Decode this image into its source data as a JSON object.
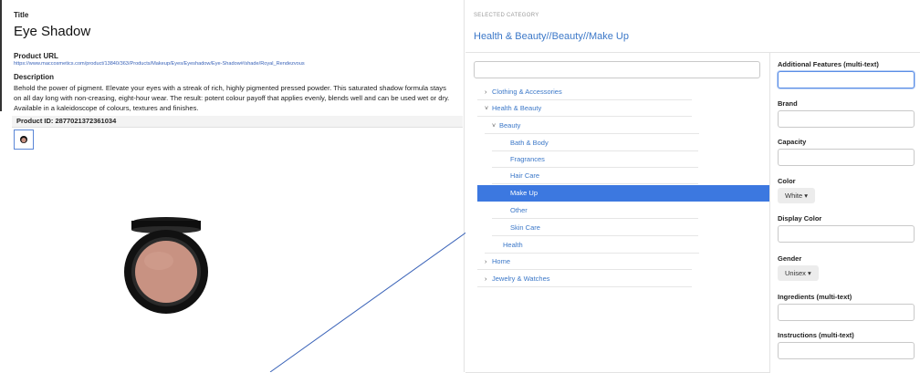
{
  "product": {
    "title_label": "Title",
    "title": "Eye Shadow",
    "url_label": "Product URL",
    "url": "https://www.maccosmetics.com/product/13840/363/Products/Makeup/Eyes/Eyeshadow/Eye-Shadow#/shade/Royal_Rendezvous",
    "description_label": "Description",
    "description": "Behold the power of pigment. Elevate your eyes with a streak of rich, highly pigmented pressed powder. This saturated shadow formula stays on all day long with non-creasing, eight-hour wear. The result: potent colour payoff that applies evenly, blends well and can be used wet or dry. Available in a kaleidoscope of colours, textures and finishes.",
    "product_id": "Product ID: 2877021372361034",
    "image_name": "eyeshadow-compact-image"
  },
  "category": {
    "caption": "SELECTED CATEGORY",
    "path": "Health & Beauty//Beauty//Make Up",
    "search_value": "",
    "tree": [
      {
        "label": "Clothing & Accessories",
        "chevron": "›",
        "selected": false
      },
      {
        "label": "Health & Beauty",
        "chevron": "˅",
        "selected": false
      },
      {
        "label": "Beauty",
        "chevron": "˅",
        "selected": false
      },
      {
        "label": "Bath & Body",
        "chevron": "",
        "selected": false
      },
      {
        "label": "Fragrances",
        "chevron": "",
        "selected": false
      },
      {
        "label": "Hair Care",
        "chevron": "",
        "selected": false
      },
      {
        "label": "Make Up",
        "chevron": "",
        "selected": true
      },
      {
        "label": "Other",
        "chevron": "",
        "selected": false
      },
      {
        "label": "Skin Care",
        "chevron": "",
        "selected": false
      },
      {
        "label": "Health",
        "chevron": "",
        "selected": false
      },
      {
        "label": "Home",
        "chevron": "›",
        "selected": false
      },
      {
        "label": "Jewelry & Watches",
        "chevron": "›",
        "selected": false
      }
    ]
  },
  "fields": {
    "additional_features": {
      "label": "Additional Features (multi-text)",
      "value": ""
    },
    "brand": {
      "label": "Brand",
      "value": ""
    },
    "capacity": {
      "label": "Capacity",
      "value": ""
    },
    "color": {
      "label": "Color",
      "selected": "White ▾"
    },
    "display_color": {
      "label": "Display Color",
      "value": ""
    },
    "gender": {
      "label": "Gender",
      "selected": "Unisex ▾"
    },
    "ingredients": {
      "label": "Ingredients (multi-text)",
      "value": ""
    },
    "instructions": {
      "label": "Instructions (multi-text)",
      "value": ""
    }
  },
  "colors": {
    "link": "#3c78c8",
    "selected_row": "#3c78e0",
    "shadow_pan": "#c89282",
    "compact": "#111111"
  }
}
